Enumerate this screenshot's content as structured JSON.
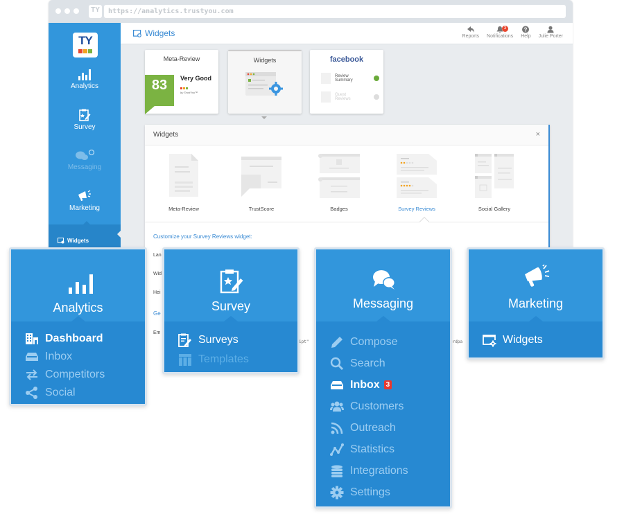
{
  "browser": {
    "favicon": "TY",
    "url": "https://analytics.trustyou.com"
  },
  "sidebar": {
    "logo": "TY",
    "logo_colors": [
      "#e8472f",
      "#f3a321",
      "#7bb342"
    ],
    "items": [
      {
        "label": "Analytics",
        "icon": "bar-chart-icon"
      },
      {
        "label": "Survey",
        "icon": "clipboard-star-icon"
      },
      {
        "label": "Messaging",
        "icon": "chat-bubbles-icon",
        "state": "disabled"
      },
      {
        "label": "Marketing",
        "icon": "megaphone-icon"
      }
    ],
    "sub_item": {
      "label": "Widgets",
      "icon": "widget-window-icon"
    }
  },
  "header": {
    "title": "Widgets",
    "actions": [
      {
        "label": "Reports",
        "icon": "reports-icon"
      },
      {
        "label": "Notifications",
        "icon": "bell-icon",
        "badge": "3"
      },
      {
        "label": "Help",
        "icon": "help-icon"
      },
      {
        "label": "Julie Porter",
        "icon": "user-icon"
      }
    ]
  },
  "cards": {
    "meta_review": {
      "title": "Meta-Review",
      "score": "83",
      "rating": "Very Good",
      "byline": "by TrustYou™"
    },
    "widgets": {
      "title": "Widgets"
    },
    "facebook": {
      "title": "facebook",
      "rows": [
        {
          "label": "Review Summary",
          "checked": true
        },
        {
          "label": "Guest Reviews",
          "checked": false
        }
      ]
    }
  },
  "panel": {
    "title": "Widgets",
    "close": "×",
    "types": [
      {
        "label": "Meta-Review"
      },
      {
        "label": "TrustScore"
      },
      {
        "label": "Badges"
      },
      {
        "label": "Survey Reviews",
        "active": true
      },
      {
        "label": "Social Gallery"
      }
    ],
    "customize_label": "Customize your Survey Reviews widget:",
    "form_labels": [
      "Lan",
      "Wid",
      "Hei",
      "Ge",
      "Em"
    ],
    "code_fragments": [
      "ipt\"",
      "3rdpa"
    ]
  },
  "menus": {
    "analytics": {
      "title": "Analytics",
      "items": [
        {
          "label": "Dashboard",
          "icon": "building-icon",
          "active": true
        },
        {
          "label": "Inbox",
          "icon": "inbox-tray-icon"
        },
        {
          "label": "Competitors",
          "icon": "swap-arrows-icon"
        },
        {
          "label": "Social",
          "icon": "share-icon"
        }
      ]
    },
    "survey": {
      "title": "Survey",
      "items": [
        {
          "label": "Surveys",
          "icon": "clipboard-pen-icon",
          "active": true
        },
        {
          "label": "Templates",
          "icon": "template-icon",
          "disabled": true
        }
      ]
    },
    "messaging": {
      "title": "Messaging",
      "items": [
        {
          "label": "Compose",
          "icon": "pencil-icon"
        },
        {
          "label": "Search",
          "icon": "search-icon"
        },
        {
          "label": "Inbox",
          "icon": "inbox-tray-icon",
          "active": true,
          "badge": "3"
        },
        {
          "label": "Customers",
          "icon": "users-icon"
        },
        {
          "label": "Outreach",
          "icon": "rss-icon"
        },
        {
          "label": "Statistics",
          "icon": "line-chart-icon"
        },
        {
          "label": "Integrations",
          "icon": "database-icon"
        },
        {
          "label": "Settings",
          "icon": "gear-icon"
        }
      ]
    },
    "marketing": {
      "title": "Marketing",
      "items": [
        {
          "label": "Widgets",
          "icon": "widget-window-icon",
          "active": true
        }
      ]
    }
  },
  "colors": {
    "brand_blue": "#3296dc",
    "brand_blue_dark": "#2789d2",
    "link_blue": "#3a8bd4",
    "score_green": "#7bb342",
    "badge_red": "#e8392f",
    "facebook_blue": "#3b5998"
  }
}
